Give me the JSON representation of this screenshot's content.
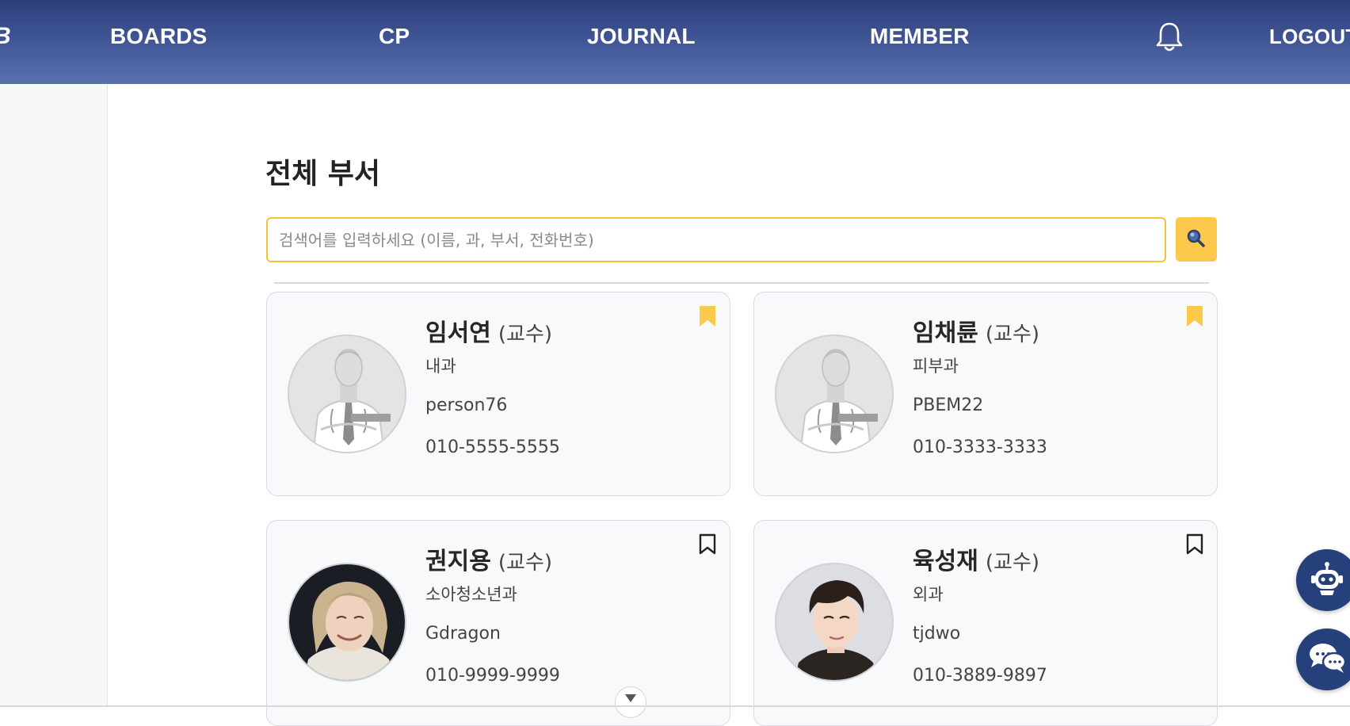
{
  "nav": {
    "logo": "B",
    "items": [
      {
        "label": "BOARDS"
      },
      {
        "label": "CP"
      },
      {
        "label": "JOURNAL"
      },
      {
        "label": "MEMBER"
      }
    ],
    "logout": "LOGOUT",
    "icons": {
      "notification": "bell-icon"
    }
  },
  "main": {
    "title": "전체 부서",
    "search": {
      "placeholder": "검색어를 입력하세요 (이름, 과, 부서, 전화번호)",
      "value": "",
      "button_icon": "search-icon"
    },
    "cards": [
      {
        "name": "임서연",
        "role": "(교수)",
        "dept": "내과",
        "id": "person76",
        "phone": "010-5555-5555",
        "bookmarked": true,
        "avatar": "doctor-placeholder"
      },
      {
        "name": "임채륜",
        "role": "(교수)",
        "dept": "피부과",
        "id": "PBEM22",
        "phone": "010-3333-3333",
        "bookmarked": true,
        "avatar": "doctor-placeholder"
      },
      {
        "name": "권지용",
        "role": "(교수)",
        "dept": "소아청소년과",
        "id": "Gdragon",
        "phone": "010-9999-9999",
        "bookmarked": false,
        "avatar": "photo"
      },
      {
        "name": "육성재",
        "role": "(교수)",
        "dept": "외과",
        "id": "tjdwo",
        "phone": "010-3889-9897",
        "bookmarked": false,
        "avatar": "photo"
      }
    ]
  },
  "floating": {
    "chatbot_icon": "robot-icon",
    "chat_icon": "chat-bubbles-icon",
    "scroll_icon": "chevron-down-icon"
  },
  "colors": {
    "header_top": "#2c3f7c",
    "header_bottom": "#5a71ae",
    "accent_yellow": "#fdc94d",
    "search_border": "#f3c13a",
    "fab_blue": "#25407a"
  }
}
